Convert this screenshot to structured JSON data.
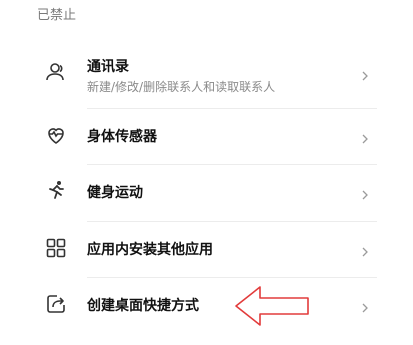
{
  "section": {
    "label": "已禁止"
  },
  "items": [
    {
      "title": "通讯录",
      "subtitle": "新建/修改/删除联系人和读取联系人",
      "icon": "contacts-icon"
    },
    {
      "title": "身体传感器",
      "subtitle": "",
      "icon": "heart-rate-icon"
    },
    {
      "title": "健身运动",
      "subtitle": "",
      "icon": "running-icon"
    },
    {
      "title": "应用内安装其他应用",
      "subtitle": "",
      "icon": "apps-grid-icon"
    },
    {
      "title": "创建桌面快捷方式",
      "subtitle": "",
      "icon": "shortcut-icon"
    }
  ],
  "colors": {
    "annotation_arrow": "#e23b3b",
    "divider": "#ececec",
    "icon": "#333333"
  }
}
